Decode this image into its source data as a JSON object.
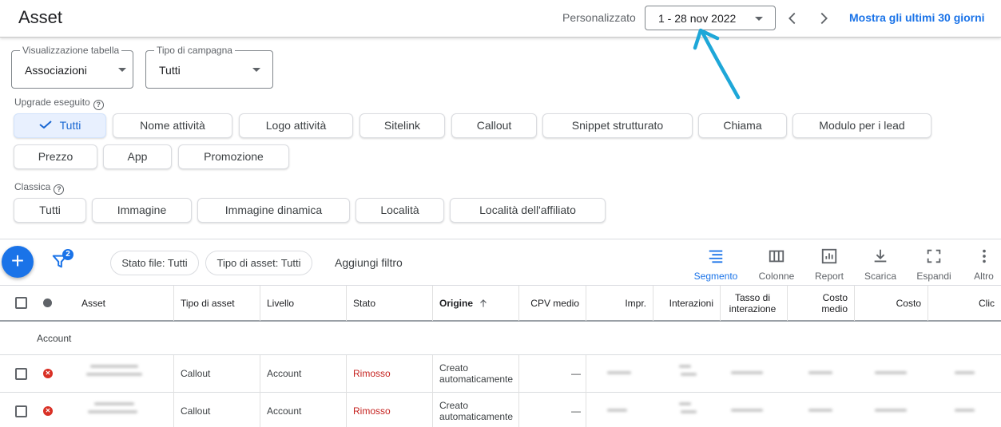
{
  "header": {
    "title": "Asset",
    "date_range_label": "Personalizzato",
    "date_range_value": "1 - 28 nov 2022",
    "show_last_link": "Mostra gli ultimi 30 giorni"
  },
  "filters": {
    "table_view": {
      "label": "Visualizzazione tabella",
      "value": "Associazioni"
    },
    "campaign_type": {
      "label": "Tipo di campagna",
      "value": "Tutti"
    }
  },
  "upgraded": {
    "label": "Upgrade eseguito",
    "chips": [
      "Tutti",
      "Nome attività",
      "Logo attività",
      "Sitelink",
      "Callout",
      "Snippet strutturato",
      "Chiama",
      "Modulo per i lead",
      "Prezzo",
      "App",
      "Promozione"
    ],
    "selected": "Tutti"
  },
  "classic": {
    "label": "Classica",
    "chips": [
      "Tutti",
      "Immagine",
      "Immagine dinamica",
      "Località",
      "Località dell'affiliato"
    ]
  },
  "toolbar": {
    "filter_count": "2",
    "filter_chips": [
      "Stato file: Tutti",
      "Tipo di asset: Tutti"
    ],
    "add_filter": "Aggiungi filtro",
    "tools": [
      "Segmento",
      "Colonne",
      "Report",
      "Scarica",
      "Espandi",
      "Altro"
    ]
  },
  "table": {
    "headers": {
      "asset": "Asset",
      "asset_type": "Tipo di asset",
      "level": "Livello",
      "status": "Stato",
      "origin": "Origine",
      "cpv": "CPV medio",
      "impr": "Impr.",
      "interactions": "Interazioni",
      "interaction_rate": "Tasso di interazione",
      "avg_cost": "Costo medio",
      "cost": "Costo",
      "clicks": "Clic"
    },
    "group_label": "Account",
    "rows": [
      {
        "asset_type": "Callout",
        "level": "Account",
        "status": "Rimosso",
        "origin": "Creato automaticamente",
        "cpv": "—"
      },
      {
        "asset_type": "Callout",
        "level": "Account",
        "status": "Rimosso",
        "origin": "Creato automaticamente",
        "cpv": "—"
      }
    ]
  },
  "colors": {
    "accent": "#1a73e8",
    "removed": "#c5221f",
    "annotation": "#1ea7d8"
  }
}
